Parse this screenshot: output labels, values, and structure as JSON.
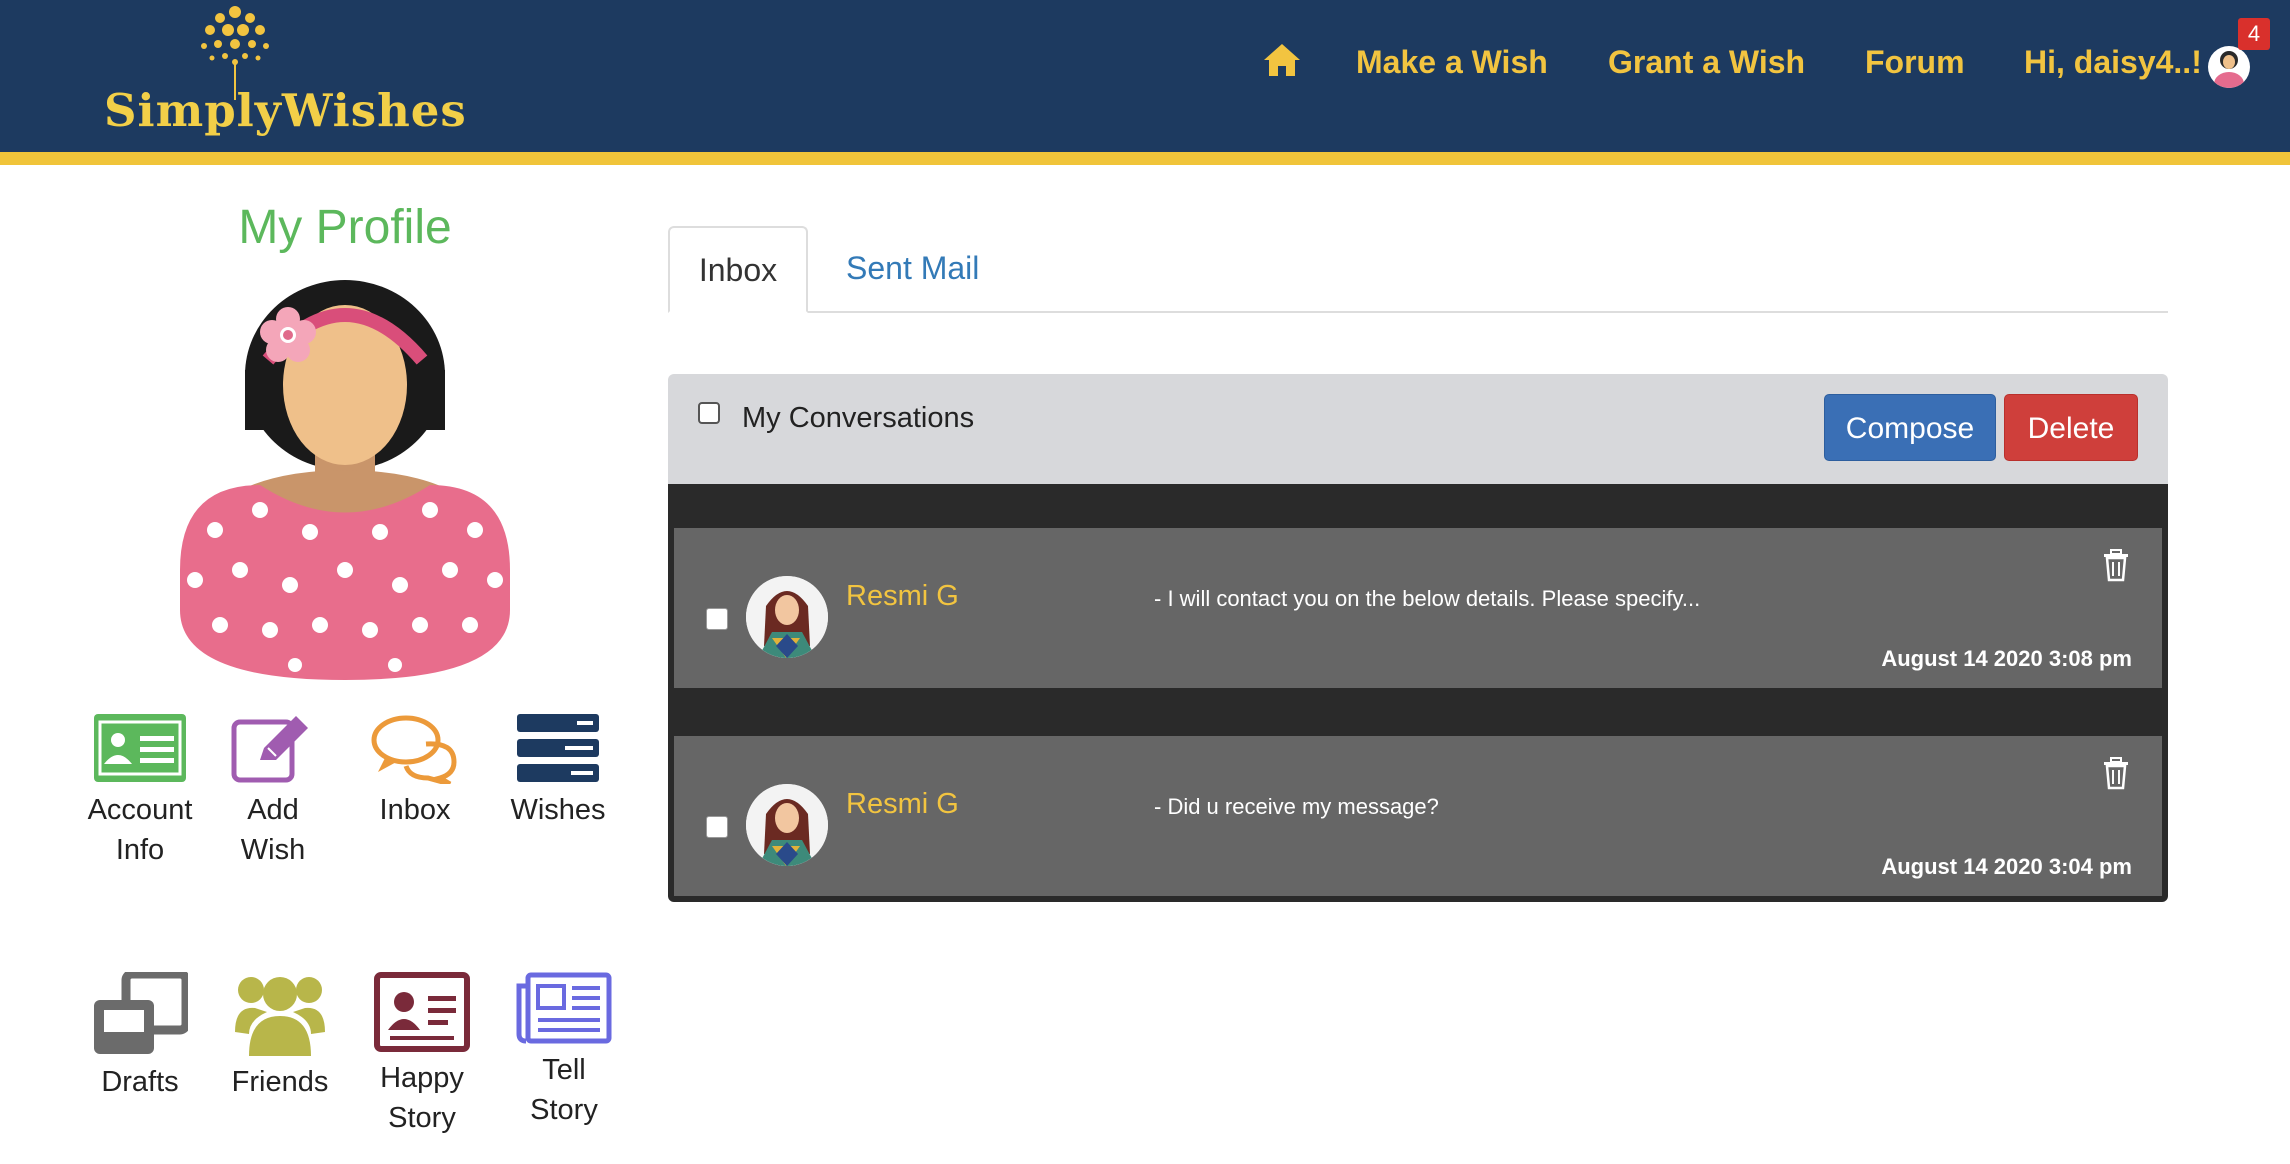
{
  "header": {
    "logo_text": "SimplyWishes",
    "nav": {
      "home_icon": "home-icon",
      "make_wish": "Make a Wish",
      "grant_wish": "Grant a Wish",
      "forum": "Forum",
      "greeting": "Hi, daisy4..!",
      "notification_count": "4"
    },
    "colors": {
      "bar": "#1d3a60",
      "accent": "#f0c43a"
    }
  },
  "profile": {
    "title": "My Profile",
    "tiles": [
      {
        "label": "Account Info",
        "icon": "id-card-icon",
        "color": "#5cb85c"
      },
      {
        "label": "Add Wish",
        "icon": "edit-icon",
        "color": "#a05cb0"
      },
      {
        "label": "Inbox",
        "icon": "chat-bubbles-icon",
        "color": "#ec9a3a"
      },
      {
        "label": "Wishes",
        "icon": "list-icon",
        "color": "#1d3a60"
      },
      {
        "label": "Drafts",
        "icon": "clone-icon",
        "color": "#6b6b6b"
      },
      {
        "label": "Friends",
        "icon": "users-icon",
        "color": "#b8b64a"
      },
      {
        "label": "Happy Story",
        "icon": "contact-card-icon",
        "color": "#7a2a3a"
      },
      {
        "label": "Tell Story",
        "icon": "newspaper-icon",
        "color": "#6a6ae0"
      }
    ]
  },
  "tabs": {
    "inbox": "Inbox",
    "sent": "Sent Mail"
  },
  "conversations": {
    "title": "My Conversations",
    "compose": "Compose",
    "delete": "Delete",
    "messages": [
      {
        "sender": "Resmi G",
        "preview": "- I will contact you on the below details. Please specify...",
        "date": "August 14 2020 3:08 pm"
      },
      {
        "sender": "Resmi G",
        "preview": "- Did u receive my message?",
        "date": "August 14 2020 3:04 pm"
      }
    ]
  }
}
